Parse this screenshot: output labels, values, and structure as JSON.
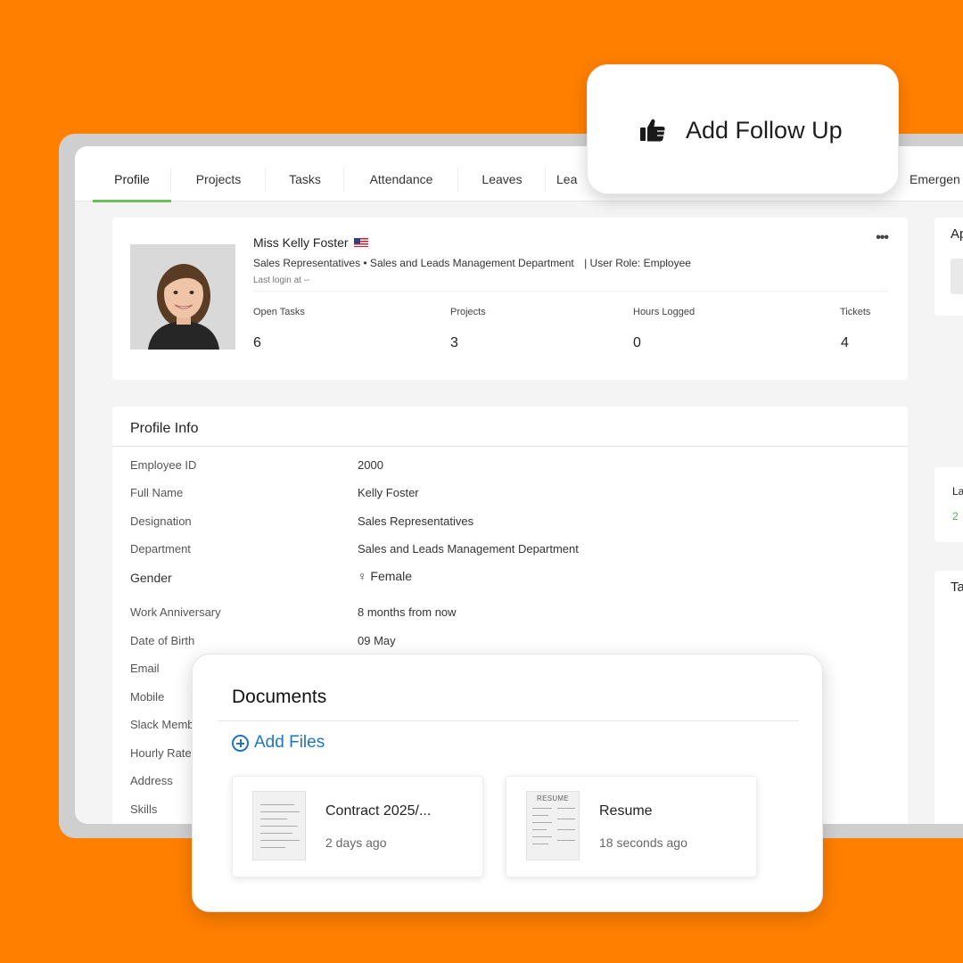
{
  "tabs": [
    {
      "label": "Profile",
      "active": true
    },
    {
      "label": "Projects"
    },
    {
      "label": "Tasks"
    },
    {
      "label": "Attendance"
    },
    {
      "label": "Leaves"
    },
    {
      "label": "Lea"
    },
    {
      "label": "Emergen"
    }
  ],
  "followup": {
    "label": "Add Follow Up",
    "icon": "thumbs-up-icon"
  },
  "profile": {
    "name": "Miss Kelly Foster",
    "flag": "us-flag-icon",
    "designation_line": "Sales Representatives • Sales and Leads Management Department",
    "role_line": "| User Role: Employee",
    "last_login": "Last login at --",
    "menu": "•••",
    "stats": [
      {
        "label": "Open Tasks",
        "value": "6"
      },
      {
        "label": "Projects",
        "value": "3"
      },
      {
        "label": "Hours Logged",
        "value": "0"
      },
      {
        "label": "Tickets",
        "value": "4"
      }
    ]
  },
  "profile_info": {
    "title": "Profile Info",
    "rows": [
      {
        "label": "Employee ID",
        "value": "2000"
      },
      {
        "label": "Full Name",
        "value": "Kelly Foster"
      },
      {
        "label": "Designation",
        "value": "Sales Representatives"
      },
      {
        "label": "Department",
        "value": "Sales and Leads Management Department"
      },
      {
        "label": "Gender",
        "value": "Female",
        "icon": "female-icon"
      },
      {
        "label": "Work Anniversary",
        "value": "8 months from now"
      },
      {
        "label": "Date of Birth",
        "value": "09 May"
      },
      {
        "label": "Email",
        "value": ""
      },
      {
        "label": "Mobile",
        "value": ""
      },
      {
        "label": "Slack Memb",
        "value": ""
      },
      {
        "label": "Hourly Rate",
        "value": ""
      },
      {
        "label": "Address",
        "value": ""
      },
      {
        "label": "Skills",
        "value": ""
      }
    ]
  },
  "side": {
    "panel1_title": "Ap",
    "panel2_title": "La",
    "panel2_value": "2",
    "panel3_title": "Ta"
  },
  "documents": {
    "title": "Documents",
    "add_label": "Add Files",
    "files": [
      {
        "name": "Contract 2025/...",
        "time": "2 days ago"
      },
      {
        "name": "Resume",
        "time": "18 seconds ago",
        "thumb_text": "RESUME"
      }
    ]
  },
  "colors": {
    "background": "#FF7F00",
    "active_tab": "#6BBE5A",
    "link": "#1F74C9"
  }
}
